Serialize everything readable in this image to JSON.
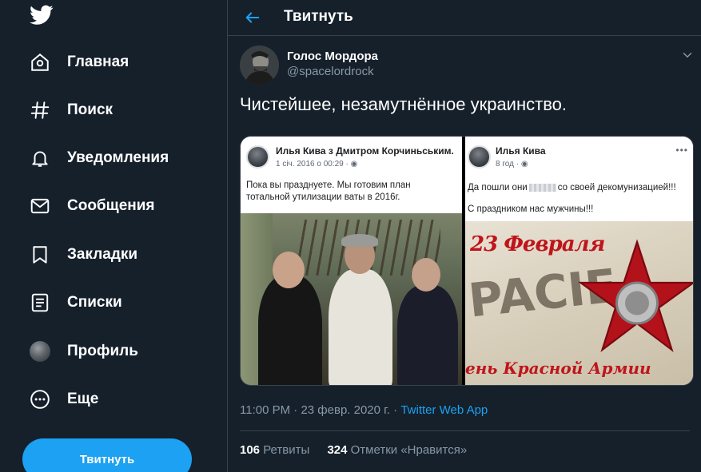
{
  "sidebar": {
    "logo": "twitter-bird-icon",
    "items": [
      {
        "label": "Главная",
        "icon": "home-icon"
      },
      {
        "label": "Поиск",
        "icon": "hashtag-icon"
      },
      {
        "label": "Уведомления",
        "icon": "bell-icon"
      },
      {
        "label": "Сообщения",
        "icon": "envelope-icon"
      },
      {
        "label": "Закладки",
        "icon": "bookmark-icon"
      },
      {
        "label": "Списки",
        "icon": "list-icon"
      },
      {
        "label": "Профиль",
        "icon": "avatar"
      },
      {
        "label": "Еще",
        "icon": "more-icon"
      }
    ],
    "tweet_button": "Твитнуть"
  },
  "header": {
    "title": "Твитнуть"
  },
  "tweet": {
    "author_name": "Голос Мордора",
    "author_handle": "@spacelordrock",
    "text": "Чистейшее, незамутнённое украинство.",
    "media": {
      "left": {
        "name": "Илья Кива з Дмитром Корчиньським.",
        "meta": "1 січ. 2016 о 00:29 · ",
        "text_line1": "Пока вы празднуете. Мы готовим план",
        "text_line2": "тотальной утилизации ваты в 2016г."
      },
      "right": {
        "name": "Илья Кива",
        "meta": "8 год · ",
        "text_before": "Да пошли они",
        "text_after": "со своей декомунизацией!!!",
        "text_line2": "С праздником нас  мужчины!!!",
        "poster_title": "23 Февраля",
        "poster_big": "PACIE",
        "poster_bottom": "ень Красной Армии"
      }
    },
    "time": "11:00 PM",
    "date": "23 февр. 2020 г.",
    "source": "Twitter Web App",
    "retweets_count": "106",
    "retweets_label": "Ретвиты",
    "likes_count": "324",
    "likes_label": "Отметки «Нравится»"
  },
  "colors": {
    "background": "#15202b",
    "accent": "#1da1f2",
    "secondary_text": "#8899a6",
    "border": "#38444d"
  }
}
